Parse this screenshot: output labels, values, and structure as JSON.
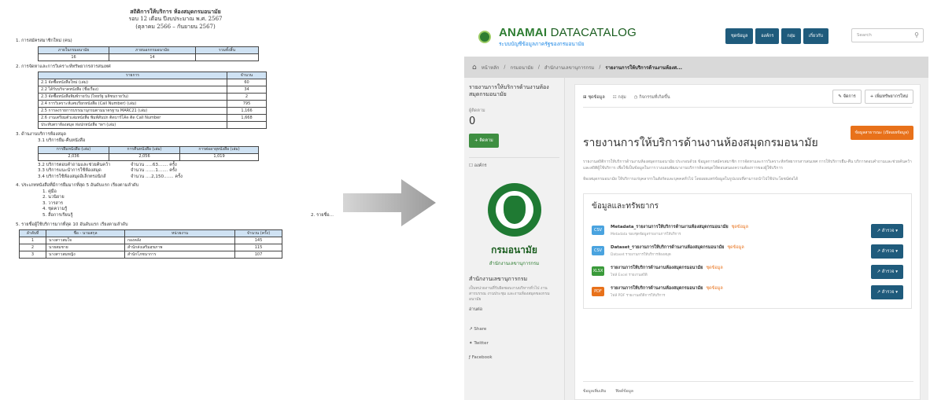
{
  "document": {
    "title_lines": [
      "สถิติการให้บริการ ห้องสมุดกรมอนามัย",
      "รอบ 12 เดือน ปีงบประมาณ พ.ศ. 2567",
      "(ตุลาคม 2566 – กันยายน 2567)"
    ],
    "s1": {
      "heading": "1. การสมัครสมาชิกใหม่ (คน)",
      "headers": [
        "ภายในกรมอนามัย",
        "ภายนอกกรมอนามัย",
        "รวมทั้งสิ้น"
      ],
      "values": [
        "16",
        "14",
        ""
      ]
    },
    "s2": {
      "heading": "2. การจัดหาและการวิเคราะห์ทรัพยากรสารสนเทศ",
      "headers": [
        "รายการ",
        "จำนวน"
      ],
      "rows": [
        {
          "item": "2.1 จัดซื้อหนังสือใหม่ (เล่ม)",
          "count": "60"
        },
        {
          "item": "2.2 ได้รับบริจาคหนังสือ (ชื่อเรื่อง)",
          "count": "34"
        },
        {
          "item": "2.3 จัดซื้อหนังสือพิมพ์รายวัน (ไทยรัฐ มติชนรายวัน)",
          "count": "2"
        },
        {
          "item": "2.4 การวิเคราะห์เลขเรียกหนังสือ (Call Number) (เล่ม)",
          "count": "795"
        },
        {
          "item": "2.5 การลงรายการบรรณานุกรมตามมาตรฐาน MARC21 (เล่ม)",
          "count": "1,166"
        },
        {
          "item": "2.6 งานเตรียมตัวเล่มหนังสือ พิมพ์สันปก ติดบาร์โค้ด ติด Call Number",
          "count": "1,668"
        },
        {
          "item": "ประทับตราห้องสมุด ห่อปกหนังสือ ฯลฯ (เล่ม)",
          "count": ""
        }
      ]
    },
    "s3": {
      "heading": "3. ด้านงานบริการห้องสมุด",
      "sub": "3.1 บริการยืม-คืนหนังสือ",
      "headers": [
        "การยืมหนังสือ (เล่ม)",
        "การคืนหนังสือ (เล่ม)",
        "การต่ออายุหนังสือ (เล่ม)"
      ],
      "values": [
        "2,036",
        "2,056",
        "1,019"
      ],
      "items": [
        {
          "label": "3.2 บริการตอบคำถามและช่วยค้นคว้า",
          "qty": "จำนวน .....63....... ครั้ง"
        },
        {
          "label": "3.3 บริการแนะนำการใช้ห้องสมุด",
          "qty": "จำนวน .......1....... ครั้ง"
        },
        {
          "label": "3.4 บริการใช้ห้องสมุดอิเล็กทรอนิกส์",
          "qty": "จำนวน ....2,150....... ครั้ง"
        }
      ]
    },
    "s4": {
      "heading": "4. ประเภทหนังสือที่มีการยืมมากที่สุด 5 อันดับแรก เรียงตามลำดับ",
      "items": [
        "1. คู่มือ",
        "2. นวนิยาย",
        "3. วารสาร",
        "4. ชุดความรู้",
        "5. สื่อการเรียนรู้"
      ],
      "note": "2. รายชื่อ..."
    },
    "s5": {
      "heading": "5. รายชื่อผู้ใช้บริการมากที่สุด 10 อันดับแรก เรียงตามลำดับ",
      "headers": [
        "ลำดับที่",
        "ชื่อ - นามสกุล",
        "หน่วยงาน",
        "จำนวน (ครั้ง)"
      ],
      "rows": [
        {
          "no": "1",
          "name": "นางสาวสมใจ",
          "unit": "กองคลัง",
          "count": "145"
        },
        {
          "no": "2",
          "name": "นายสมชาย",
          "unit": "สำนักส่งเสริมสุขภาพ",
          "count": "115"
        },
        {
          "no": "3",
          "name": "นางสาวสมหญิง",
          "unit": "สำนักโภชนาการ",
          "count": "107"
        }
      ]
    }
  },
  "site": {
    "brand_prefix": "ANAMAI",
    "brand_suffix": " DATACATALOG",
    "brand_sub": "ระบบบัญชีข้อมูลภาครัฐของกรมอนามัย",
    "nav": [
      "ชุดข้อมูล",
      "องค์กร",
      "กลุ่ม",
      "เกี่ยวกับ"
    ],
    "search_placeholder": "Search",
    "breadcrumb": [
      "หน้าหลัก",
      "กรมอนามัย",
      "สำนักงานเลขานุการกรม",
      "รายงานการให้บริการด้านงานห้องส..."
    ],
    "sidebar": {
      "title": "รายงานการให้บริการด้านงานห้องสมุดกรมอนามัย",
      "followers_label": "ผู้ติดตาม",
      "followers": "0",
      "follow_btn": "ติดตาม",
      "org_section": "องค์กร",
      "org_name": "กรมอนามัย",
      "org_subtitle": "สำนักงานเลขานุการกรม",
      "org_heading": "สำนักงานเลขานุการกรม",
      "org_desc": "เป็นหน่วยงานที่รับผิดชอบงานบริหารทั่วไป งานสารบรรณ งานประชุม และงานห้องสมุดของกรมอนามัย",
      "more": "อ่านต่อ",
      "links": [
        "Share",
        "Twitter",
        "Facebook"
      ]
    },
    "tabs": [
      "ชุดข้อมูล",
      "กลุ่ม",
      "กิจกรรมที่เกิดขึ้น"
    ],
    "actions": [
      "จัดการ",
      "เพิ่มทรัพยากรใหม่"
    ],
    "badge": "ข้อมูลสาธารณะ (เปิดเผยข้อมูล)",
    "dataset_title": "รายงานการให้บริการด้านงานห้องสมุดกรมอนามัย",
    "dataset_desc_1": "รายงานสถิติการให้บริการด้านงานห้องสมุดกรมอนามัย ประกอบด้วย ข้อมูลการสมัครสมาชิก การจัดหาและการวิเคราะห์ทรัพยากรสารสนเทศ การให้บริการยืม-คืน บริการตอบคำถามและช่วยค้นคว้า และสถิติผู้ใช้บริการ เพื่อใช้เป็นข้อมูลในการวางแผนพัฒนางานบริการห้องสมุดให้ตอบสนองความต้องการของผู้ใช้บริการ",
    "dataset_desc_2": "ห้องสมุดกรมอนามัย ให้บริการแก่บุคลากรในสังกัดและบุคคลทั่วไป โดยเผยแพร่ข้อมูลในรูปแบบที่สามารถนำไปใช้ประโยชน์ต่อได้",
    "resources_heading": "ข้อมูลและทรัพยากร",
    "resources": [
      {
        "format": "CSV",
        "color": "#4aa3df",
        "name": "Metadata_รายงานการให้บริการด้านงานห้องสมุดกรมอนามัย",
        "tag": "ชุดข้อมูล",
        "sub": "Metadata ของชุดข้อมูลรายงานการให้บริการ",
        "btn": "สำรวจ"
      },
      {
        "format": "CSV",
        "color": "#4aa3df",
        "name": "Dataset_รายงานการให้บริการด้านงานห้องสมุดกรมอนามัย",
        "tag": "ชุดข้อมูล",
        "sub": "Dataset รายงานการให้บริการห้องสมุด",
        "btn": "สำรวจ"
      },
      {
        "format": "XLSX",
        "color": "#3a9a3a",
        "name": "รายงานการให้บริการด้านงานห้องสมุดกรมอนามัย",
        "tag": "ชุดข้อมูล",
        "sub": "ไฟล์ Excel รายงานสถิติ",
        "btn": "สำรวจ"
      },
      {
        "format": "PDF",
        "color": "#e8711a",
        "name": "รายงานการให้บริการด้านงานห้องสมุดกรมอนามัย",
        "tag": "ชุดข้อมูล",
        "sub": "ไฟล์ PDF รายงานสถิติการให้บริการ",
        "btn": "สำรวจ"
      }
    ],
    "bottom_tabs": [
      "ข้อมูลเพิ่มเติม",
      "ฟิลด์ข้อมูล"
    ]
  }
}
